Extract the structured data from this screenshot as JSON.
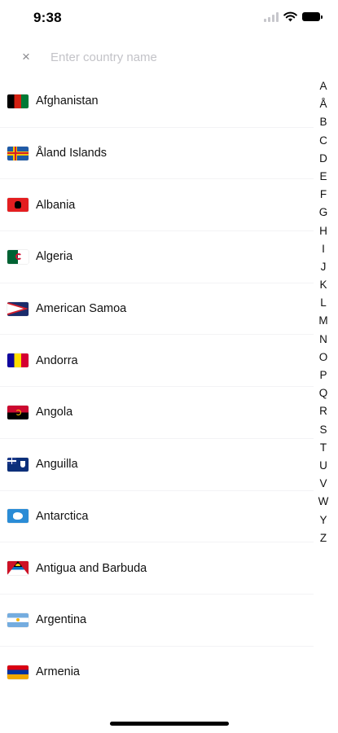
{
  "status_bar": {
    "time": "9:38",
    "icons": [
      "cellular-signal-icon",
      "wifi-icon",
      "battery-icon"
    ]
  },
  "search": {
    "clear_icon": "×",
    "placeholder": "Enter country name",
    "value": ""
  },
  "countries": [
    {
      "name": "Afghanistan",
      "flag": "af"
    },
    {
      "name": "Åland Islands",
      "flag": "ax"
    },
    {
      "name": "Albania",
      "flag": "al"
    },
    {
      "name": "Algeria",
      "flag": "dz"
    },
    {
      "name": "American Samoa",
      "flag": "as"
    },
    {
      "name": "Andorra",
      "flag": "ad"
    },
    {
      "name": "Angola",
      "flag": "ao"
    },
    {
      "name": "Anguilla",
      "flag": "ai"
    },
    {
      "name": "Antarctica",
      "flag": "aq"
    },
    {
      "name": "Antigua and Barbuda",
      "flag": "ag"
    },
    {
      "name": "Argentina",
      "flag": "ar"
    },
    {
      "name": "Armenia",
      "flag": "am"
    }
  ],
  "alphabet_index": [
    "A",
    "Å",
    "B",
    "C",
    "D",
    "E",
    "F",
    "G",
    "H",
    "I",
    "J",
    "K",
    "L",
    "M",
    "N",
    "O",
    "P",
    "Q",
    "R",
    "S",
    "T",
    "U",
    "V",
    "W",
    "Y",
    "Z"
  ],
  "colors": {
    "placeholder": "#c3c3c8",
    "separator": "#f3f3f5",
    "text": "#111111"
  }
}
